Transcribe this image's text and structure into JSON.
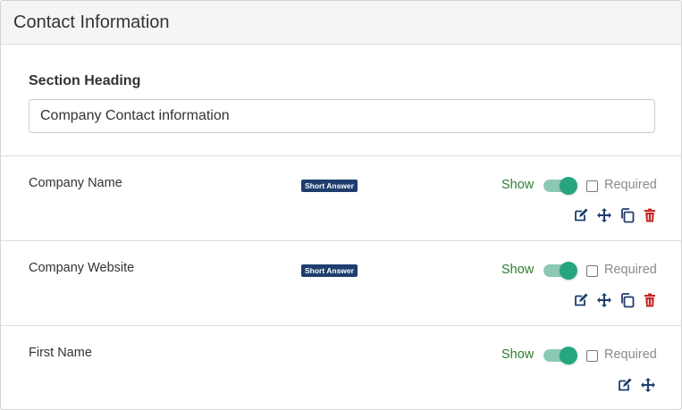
{
  "panel": {
    "title": "Contact Information"
  },
  "section": {
    "label": "Section Heading",
    "value": "Company Contact information"
  },
  "fields": [
    {
      "label": "Company Name",
      "badge": "Short Answer",
      "show_label": "Show",
      "show_on": true,
      "required_label": "Required",
      "required": false,
      "actions": [
        "edit-icon",
        "move-icon",
        "copy-icon",
        "trash-icon"
      ]
    },
    {
      "label": "Company Website",
      "badge": "Short Answer",
      "show_label": "Show",
      "show_on": true,
      "required_label": "Required",
      "required": false,
      "actions": [
        "edit-icon",
        "move-icon",
        "copy-icon",
        "trash-icon"
      ]
    },
    {
      "label": "First Name",
      "badge": "",
      "show_label": "Show",
      "show_on": true,
      "required_label": "Required",
      "required": false,
      "actions": [
        "edit-icon",
        "move-icon"
      ]
    }
  ],
  "colors": {
    "badge_bg": "#1f3d6e",
    "show_green": "#2e7d32",
    "toggle_knob": "#26a57f",
    "toggle_track": "#8cc9b4",
    "icon_blue": "#1f3d6e",
    "icon_red": "#c62828"
  }
}
